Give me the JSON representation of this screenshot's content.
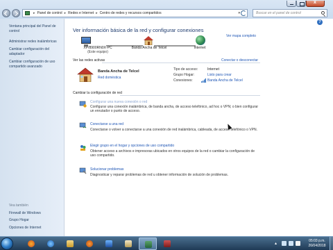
{
  "window": {
    "breadcrumb": [
      "Panel de control",
      "Redes e Internet",
      "Centro de redes y recursos compartidos"
    ],
    "search_placeholder": "Buscar en el panel de control",
    "help": "?"
  },
  "sidebar": {
    "items": [
      {
        "label": "Ventana principal del Panel de control"
      },
      {
        "label": "Administrar redes inalámbricas"
      },
      {
        "label": "Cambiar configuración del adaptador"
      },
      {
        "label": "Cambiar configuración de uso compartido avanzado"
      }
    ],
    "see_also_title": "Vea también",
    "see_also": [
      {
        "label": "Firewall de Windows"
      },
      {
        "label": "Grupo Hogar"
      },
      {
        "label": "Opciones de Internet"
      }
    ]
  },
  "main": {
    "title": "Ver información básica de la red y configurar conexiones",
    "full_map_link": "Ver mapa completo",
    "map": {
      "pc_name": "XP/8900RN0X-PC",
      "pc_sub": "(Este equipo)",
      "network": "Banda Ancha de Telcel",
      "internet": "Internet"
    },
    "active_networks_title": "Ver las redes activas",
    "connect_link": "Conectar o desconectar",
    "active_network": {
      "name": "Banda Ancha de Telcel",
      "type": "Red doméstica",
      "access_label": "Tipo de acceso:",
      "access_value": "Internet",
      "homegroup_label": "Grupo Hogar:",
      "homegroup_value": "Listo para crear",
      "connections_label": "Conexiones:",
      "connections_value": "Banda Ancha de Telcel"
    },
    "change_title": "Cambiar la configuración de red",
    "tasks": [
      {
        "link": "Configurar una nueva conexión o red",
        "desc": "Configurar una conexión inalámbrica, de banda ancha, de acceso telefónico, ad hoc o VPN; o bien configurar un enrutador o punto de acceso."
      },
      {
        "link": "Conectarse a una red",
        "desc": "Conectarse o volver a conectarse a una conexión de red inalámbrica, cableada, de acceso telefónico o VPN."
      },
      {
        "link": "Elegir grupo en el hogar y opciones de uso compartido",
        "desc": "Obtener acceso a archivos e impresoras ubicados en otros equipos de la red o cambiar la configuración de uso compartido."
      },
      {
        "link": "Solucionar problemas",
        "desc": "Diagnosticar y reparar problemas de red u obtener información de solución de problemas."
      }
    ]
  },
  "taskbar": {
    "time": "05:03 p.m.",
    "date": "26/04/2018"
  }
}
